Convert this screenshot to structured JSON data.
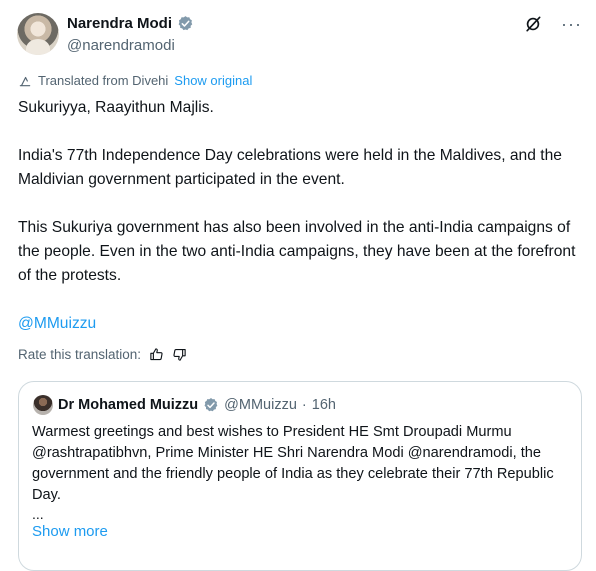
{
  "author": {
    "name": "Narendra Modi",
    "handle": "@narendramodi"
  },
  "top_actions": {
    "grok_icon": "grok-slash-icon",
    "more_icon": "more-icon",
    "more_glyph": "···"
  },
  "translation": {
    "label": "Translated from Divehi",
    "show_original": "Show original"
  },
  "tweet": {
    "paragraphs": [
      "Sukuriyya, Raayithun Majlis.",
      "India's 77th Independence Day celebrations were held in the Maldives, and the Maldivian government participated in the event.",
      "This Sukuriya government has also been involved in the anti-India campaigns of the people. Even in the two anti-India campaigns, they have been at the forefront of the protests."
    ],
    "mention": "@MMuizzu"
  },
  "rate": {
    "label": "Rate this translation:"
  },
  "quoted": {
    "name": "Dr Mohamed Muizzu",
    "handle": "@MMuizzu",
    "dot": "·",
    "time": "16h",
    "text": "Warmest greetings and best wishes to President HE Smt Droupadi Murmu @rashtrapatibhvn, Prime Minister HE Shri Narendra Modi @narendramodi, the government and the friendly people of India as they celebrate their 77th Republic Day.",
    "ellipsis": "...",
    "show_more": "Show more"
  },
  "colors": {
    "accent": "#1d9bf0",
    "muted": "#536471",
    "text": "#0f1419",
    "border": "#cfd9de"
  }
}
